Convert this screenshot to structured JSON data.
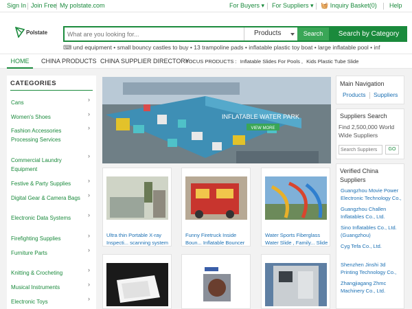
{
  "topbar": {
    "sign_in": "Sign In",
    "join_free": "Join Free",
    "my_account": "My polstate.com",
    "for_buyers": "For Buyers",
    "for_suppliers": "For Suppliers",
    "inquiry_basket": "Inquiry Basket(0)",
    "help": "Help"
  },
  "logo": {
    "name": "Polstate"
  },
  "search": {
    "placeholder": "What are you looking for...",
    "category": "Products",
    "button": "Search",
    "by_category": "Search by Category"
  },
  "hot_searches": [
    "und equipment",
    "small bouncy castles to buy",
    "13 trampoline pads",
    "inflatable plastic toy boat",
    "large inflatable pool",
    "inf"
  ],
  "nav": {
    "home": "HOME",
    "china_products": "CHINA PRODUCTS",
    "supplier_directory": "CHINA SUPPLIER DIRECTORY",
    "focus_label": "FOCUS PRODUCTS :",
    "focus_items": [
      "Inflatable Slides For Pools",
      "Kids Plastic Tube Slide"
    ]
  },
  "categories": {
    "title": "CATEGORIES",
    "items": [
      "Cans",
      "Women's Shoes",
      "Fashion Accessories Processing Services",
      "Commercial Laundry Equipment",
      "Festive & Party Supplies",
      "Digital Gear & Camera Bags",
      "Electronic Data Systems",
      "Firefighting Supplies",
      "Furniture Parts",
      "Knitting & Crocheting",
      "Musical Instruments",
      "Electronic Toys"
    ]
  },
  "banner": {
    "headline": "INFLATABLE WATER PARK",
    "button": "VIEW MORE",
    "active_slide": 1,
    "slide_count": 3,
    "colors": {
      "active": "#e07a7a",
      "inactive": "#3fb6c9"
    }
  },
  "products": [
    {
      "caption": "Ultra thin Portable X-ray Inspecti... scanning system"
    },
    {
      "caption": "Funny Firetruck Inside Boun... Inflatable Bouncer"
    },
    {
      "caption": "Water Sports Fiberglass Water Slide , Family... Slide"
    },
    {
      "caption": ""
    },
    {
      "caption": ""
    },
    {
      "caption": ""
    }
  ],
  "right": {
    "main_nav_title": "Main Navigation",
    "products": "Products",
    "suppliers": "Suppliers",
    "suppliers_search_title": "Suppliers Search",
    "find_text": "Find 2,500,000 World Wide Suppliers",
    "search_placeholder": "Search Suppliers",
    "go": "GO",
    "verified_title": "Verified China Suppliers",
    "verified": [
      "Guangzhou Movie Power Electronic Technology Co.,",
      "Guangzhou Challen Inflatables Co., Ltd.",
      "Sino Inflatables Co., Ltd. (Guangzhou)",
      "Cyg Tefa Co., Ltd.",
      "Shenzhen Jinshi 3d Printing Technology Co.,",
      "Zhangjiagang Zhmc Machinery Co., Ltd."
    ]
  },
  "colors": {
    "brand_green": "#1a8a3c",
    "link_blue": "#1a6fb3"
  }
}
